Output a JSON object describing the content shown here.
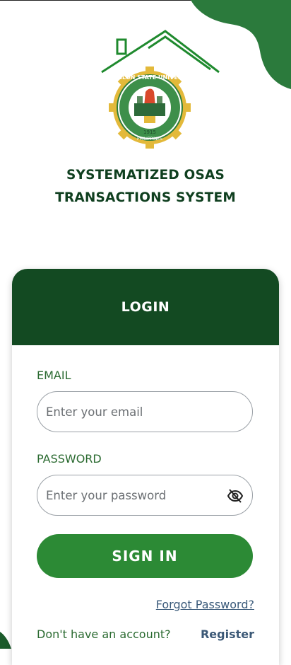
{
  "header": {
    "title": "SYSTEMATIZED OSAS TRANSACTIONS SYSTEM"
  },
  "logo": {
    "university_name": "ROMBLON STATE UNIVERSITY",
    "year": "1915",
    "country": "PHILIPPINES"
  },
  "login_card": {
    "title": "LOGIN",
    "email_label": "EMAIL",
    "email_placeholder": "Enter your email",
    "password_label": "PASSWORD",
    "password_placeholder": "Enter your password",
    "sign_in_label": "SIGN IN",
    "forgot_password_label": "Forgot Password?",
    "no_account_text": "Don't have an account?",
    "register_label": "Register"
  },
  "icons": {
    "password_toggle": "eye-slash-icon"
  },
  "colors": {
    "dark_green": "#134a22",
    "accent_green": "#2c8a35",
    "link_blue": "#3a5a7a"
  }
}
